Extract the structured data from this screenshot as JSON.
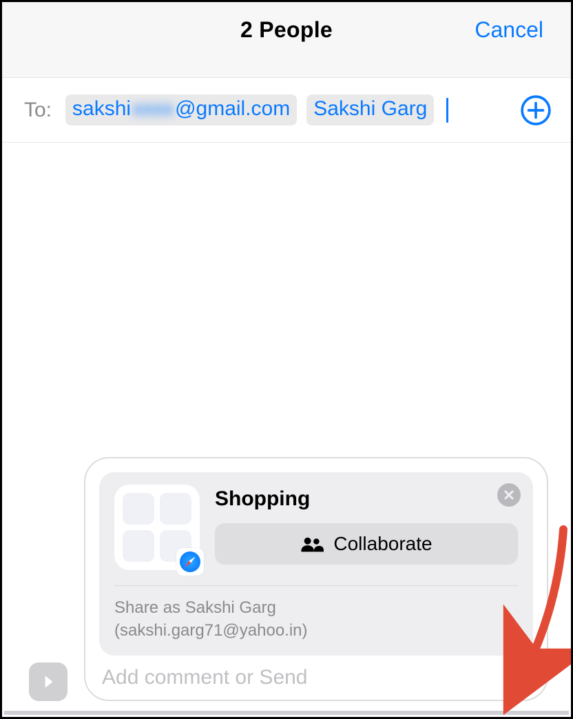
{
  "navbar": {
    "title": "2 People",
    "cancel_label": "Cancel"
  },
  "to": {
    "label": "To:",
    "recipients": [
      {
        "prefix": "sakshi",
        "blurred": "xxxx",
        "suffix": "@gmail.com"
      },
      {
        "display": "Sakshi Garg"
      }
    ],
    "add_icon": "plus-circle"
  },
  "share_card": {
    "title": "Shopping",
    "collaborate_label": "Collaborate",
    "share_as_line1": "Share as Sakshi Garg",
    "share_as_line2": "(sakshi.garg71@yahoo.in)",
    "badge_icon": "safari",
    "close_icon": "xmark-circle",
    "people_icon": "people"
  },
  "compose": {
    "placeholder": "Add comment or Send",
    "apps_toggle_icon": "chevron-right",
    "send_icon": "arrow-up"
  },
  "annotation": {
    "arrow_present": true,
    "arrow_color": "#e14a34"
  }
}
